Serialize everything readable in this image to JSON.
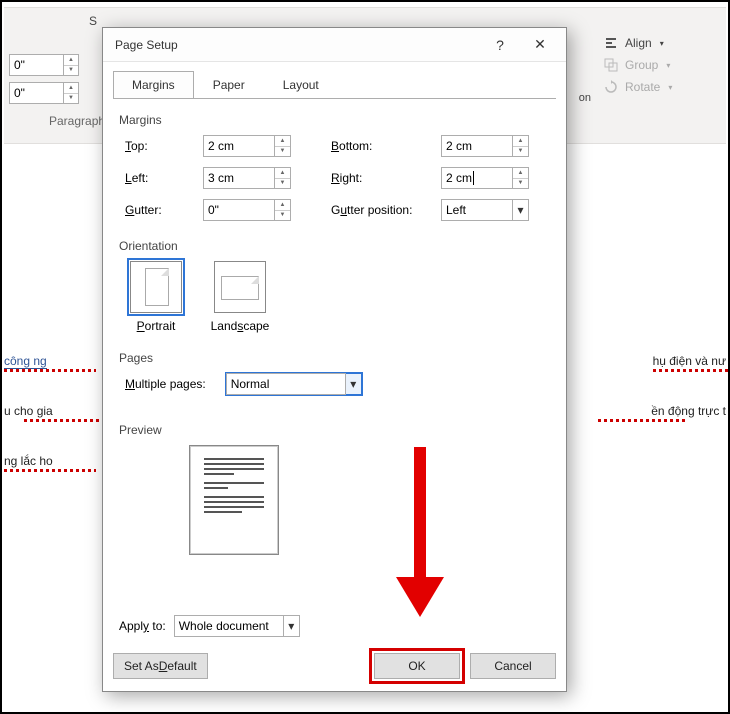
{
  "ribbon": {
    "spacing_label": "S",
    "field_a": "0\"",
    "field_b": "0\"",
    "paragraph_label": "Paragraph",
    "align": "Align",
    "group": "Group",
    "rotate": "Rotate",
    "hidden_right": "on"
  },
  "background_text": {
    "left1": "công ng",
    "right1": "hụ điện và nư",
    "left2": "u cho gia",
    "right2": "ền động trực t",
    "left3": "ng lắc ho"
  },
  "dialog": {
    "title": "Page Setup",
    "help": "?",
    "close": "✕",
    "tabs": {
      "margins": "Margins",
      "paper": "Paper",
      "layout": "Layout"
    },
    "margins": {
      "group_label": "Margins",
      "top_label": "Top:",
      "top_value": "2 cm",
      "bottom_label": "Bottom:",
      "bottom_value": "2 cm",
      "left_label": "Left:",
      "left_value": "3 cm",
      "right_label": "Right:",
      "right_value": "2 cm",
      "gutter_label": "Gutter:",
      "gutter_value": "0\"",
      "gutter_pos_label": "Gutter position:",
      "gutter_pos_value": "Left"
    },
    "orientation": {
      "group_label": "Orientation",
      "portrait": "Portrait",
      "landscape": "Landscape"
    },
    "pages": {
      "group_label": "Pages",
      "multiple_label": "Multiple pages:",
      "multiple_value": "Normal"
    },
    "preview_label": "Preview",
    "apply": {
      "label": "Apply to:",
      "value": "Whole document"
    },
    "buttons": {
      "set_default": "Set As Default",
      "ok": "OK",
      "cancel": "Cancel"
    }
  }
}
